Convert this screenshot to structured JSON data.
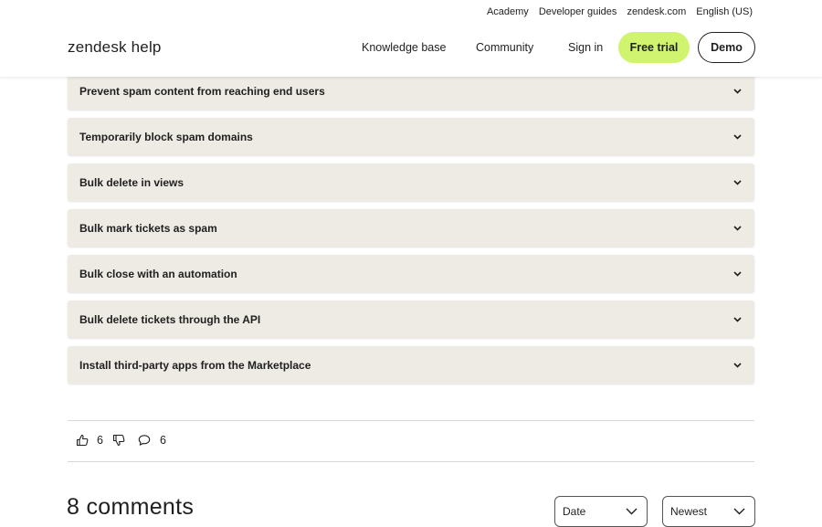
{
  "header": {
    "utility_links": [
      "Academy",
      "Developer guides",
      "zendesk.com",
      "English (US)"
    ],
    "logo": "zendesk help",
    "nav": {
      "knowledge_base": "Knowledge base",
      "community": "Community",
      "sign_in": "Sign in",
      "free_trial": "Free trial",
      "demo": "Demo"
    },
    "accent_color": "#d1f470"
  },
  "accordion": {
    "items": [
      "Prevent spam content from reaching end users",
      "Temporarily block spam domains",
      "Bulk delete in views",
      "Bulk mark tickets as spam",
      "Bulk close with an automation",
      "Bulk delete tickets through the API",
      "Install third-party apps from the Marketplace"
    ],
    "background": "#eeebe4"
  },
  "feedback": {
    "upvotes": "6",
    "comments_count": "6"
  },
  "comments": {
    "title": "8 comments",
    "sort_field": "Date",
    "sort_order": "Newest"
  }
}
